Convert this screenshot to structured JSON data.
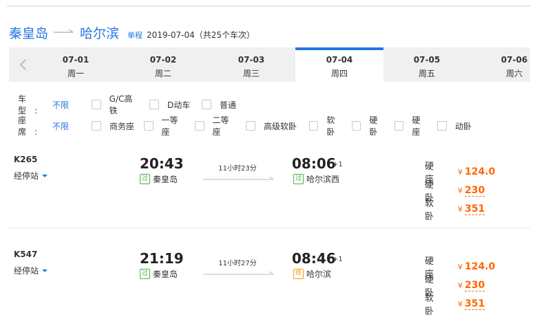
{
  "route": {
    "from": "秦皇岛",
    "to": "哈尔滨",
    "trip_type": "单程",
    "date_info": "2019-07-04（共25个车次）"
  },
  "dates": [
    {
      "date": "07-01",
      "weekday": "周一",
      "active": false
    },
    {
      "date": "07-02",
      "weekday": "周二",
      "active": false
    },
    {
      "date": "07-03",
      "weekday": "周三",
      "active": false
    },
    {
      "date": "07-04",
      "weekday": "周四",
      "active": true
    },
    {
      "date": "07-05",
      "weekday": "周五",
      "active": false
    },
    {
      "date": "07-06",
      "weekday": "周六",
      "active": false
    }
  ],
  "filters": {
    "train_type": {
      "label": "车型:",
      "selected": "不限",
      "options": [
        "G/C高铁",
        "D动车",
        "普通"
      ]
    },
    "seat": {
      "label": "座席:",
      "selected": "不限",
      "options": [
        "商务座",
        "一等座",
        "二等座",
        "高级软卧",
        "软卧",
        "硬卧",
        "硬座",
        "动卧"
      ]
    }
  },
  "stops_label": "经停站",
  "trains": [
    {
      "number": "K265",
      "depart": "20:43",
      "arrive": "08:06",
      "plus_day": "+1",
      "duration": "11小时23分",
      "from_badge": "过",
      "from_station": "秦皇岛",
      "to_badge": "过",
      "to_station": "哈尔滨西",
      "seats": [
        {
          "name": "硬座",
          "currency": "¥",
          "price": "124.0"
        },
        {
          "name": "硬卧",
          "currency": "¥",
          "price": "230"
        },
        {
          "name": "软卧",
          "currency": "¥",
          "price": "351"
        }
      ]
    },
    {
      "number": "K547",
      "depart": "21:19",
      "arrive": "08:46",
      "plus_day": "+1",
      "duration": "11小时27分",
      "from_badge": "过",
      "from_station": "秦皇岛",
      "to_badge": "终",
      "to_station": "哈尔滨",
      "seats": [
        {
          "name": "硬座",
          "currency": "¥",
          "price": "124.0"
        },
        {
          "name": "硬卧",
          "currency": "¥",
          "price": "230"
        },
        {
          "name": "软卧",
          "currency": "¥",
          "price": "351"
        }
      ]
    }
  ],
  "colors": {
    "accent": "#2577e3",
    "price": "#ff6600",
    "pass_badge": "#4cae4c",
    "end_badge": "#f39c12"
  }
}
